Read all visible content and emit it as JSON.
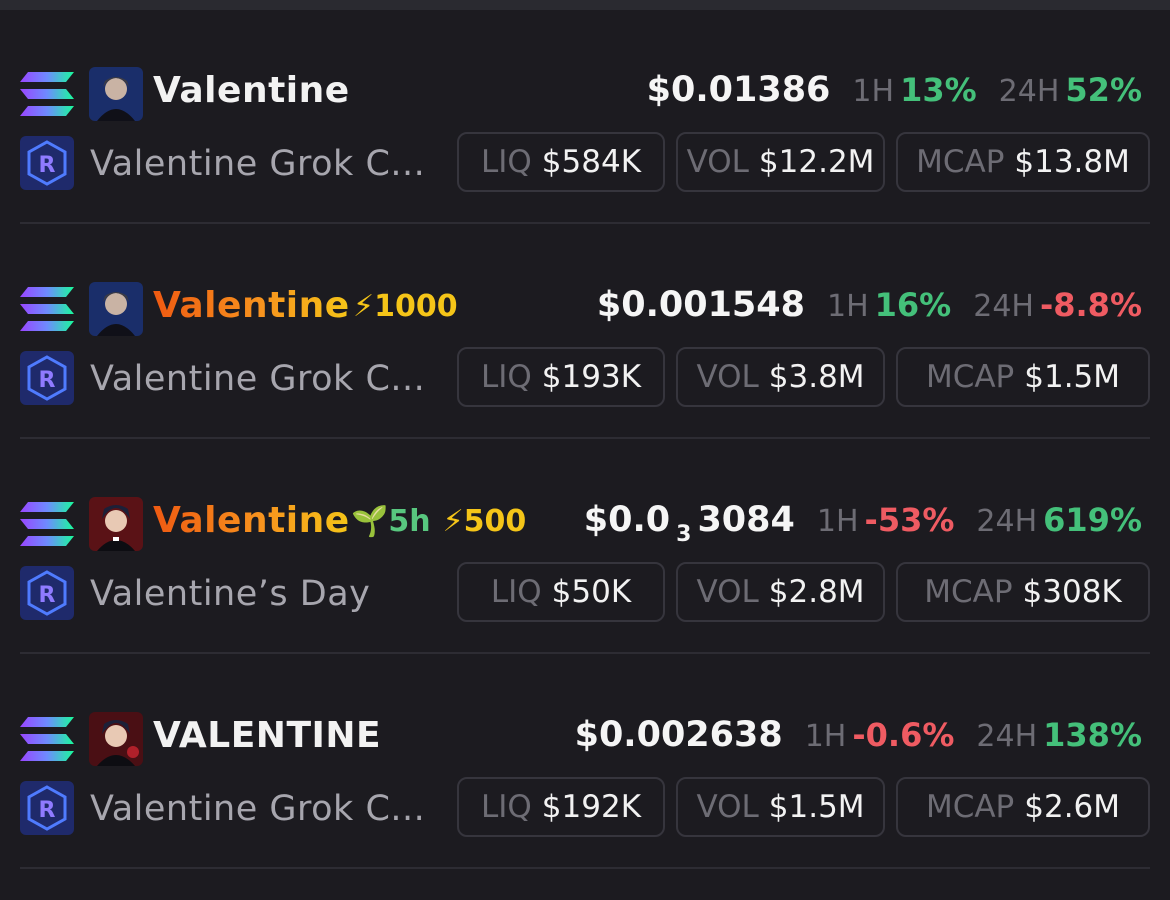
{
  "labels": {
    "h1": "1H",
    "h24": "24H",
    "liq": "LIQ",
    "vol": "VOL",
    "mcap": "MCAP"
  },
  "colors": {
    "positive": "#44c07a",
    "negative": "#ef5b62",
    "boost": "#f5c518",
    "age": "#58c77f"
  },
  "tokens": [
    {
      "name": "Valentine",
      "name_style": "white",
      "price_main": "$0.01386",
      "price_sub": "",
      "price_tail": "",
      "change_1h": "13%",
      "change_1h_dir": "pos",
      "change_24h": "52%",
      "change_24h_dir": "pos",
      "subname": "Valentine Grok C...",
      "liq": "$584K",
      "vol": "$12.2M",
      "mcap": "$13.8M",
      "age": "",
      "boost": "",
      "chain_icon": "solana-icon",
      "dex_icon": "raydium-icon"
    },
    {
      "name": "Valentine",
      "name_style": "orange",
      "price_main": "$0.001548",
      "price_sub": "",
      "price_tail": "",
      "change_1h": "16%",
      "change_1h_dir": "pos",
      "change_24h": "-8.8%",
      "change_24h_dir": "neg",
      "subname": "Valentine Grok C...",
      "liq": "$193K",
      "vol": "$3.8M",
      "mcap": "$1.5M",
      "age": "",
      "boost": "1000",
      "chain_icon": "solana-icon",
      "dex_icon": "raydium-icon"
    },
    {
      "name": "Valentine",
      "name_style": "orange",
      "price_main": "$0.0",
      "price_sub": "3",
      "price_tail": "3084",
      "change_1h": "-53%",
      "change_1h_dir": "neg",
      "change_24h": "619%",
      "change_24h_dir": "pos",
      "subname": "Valentine’s Day",
      "liq": "$50K",
      "vol": "$2.8M",
      "mcap": "$308K",
      "age": "5h",
      "boost": "500",
      "chain_icon": "solana-icon",
      "dex_icon": "raydium-icon"
    },
    {
      "name": "VALENTINE",
      "name_style": "white",
      "price_main": "$0.002638",
      "price_sub": "",
      "price_tail": "",
      "change_1h": "-0.6%",
      "change_1h_dir": "neg",
      "change_24h": "138%",
      "change_24h_dir": "pos",
      "subname": "Valentine Grok C...",
      "liq": "$192K",
      "vol": "$1.5M",
      "mcap": "$2.6M",
      "age": "",
      "boost": "",
      "chain_icon": "solana-icon",
      "dex_icon": "raydium-icon"
    }
  ]
}
